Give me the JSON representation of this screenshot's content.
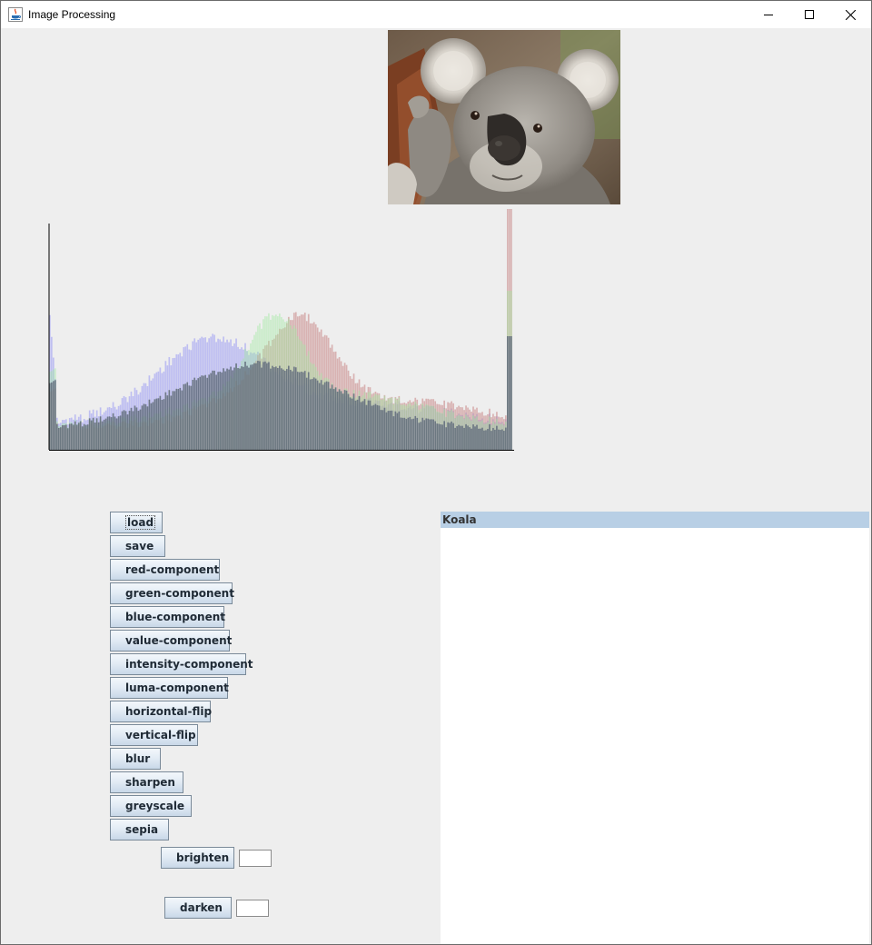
{
  "window": {
    "title": "Image Processing",
    "controls": [
      "minimize-icon",
      "maximize-icon",
      "close-icon"
    ]
  },
  "image": {
    "subject": "koala",
    "alt": "Koala"
  },
  "histogram": {
    "channels": [
      "red",
      "green",
      "blue",
      "intensity"
    ],
    "colors": {
      "red": "#c98a8a",
      "green": "#9ee89e",
      "blue": "#a9a9f2",
      "intensity": "#5f6b7a"
    }
  },
  "buttons": {
    "load": "load",
    "save": "save",
    "red_component": "red-component",
    "green_component": "green-component",
    "blue_component": "blue-component",
    "value_component": "value-component",
    "intensity_component": "intensity-component",
    "luma_component": "luma-component",
    "horizontal_flip": "horizontal-flip",
    "vertical_flip": "vertical-flip",
    "blur": "blur",
    "sharpen": "sharpen",
    "greyscale": "greyscale",
    "sepia": "sepia",
    "brighten": "brighten",
    "darken": "darken"
  },
  "inputs": {
    "brighten_value": "",
    "darken_value": ""
  },
  "image_list": {
    "items": [
      "Koala"
    ],
    "selected": "Koala"
  }
}
